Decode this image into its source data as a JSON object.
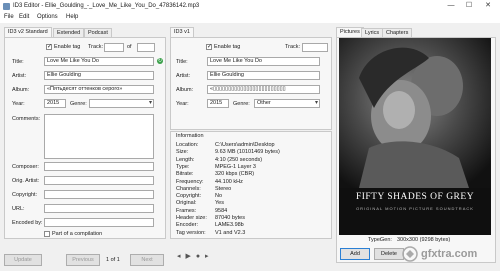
{
  "window": {
    "title": "ID3 Editor - Ellie_Goulding_-_Love_Me_Like_You_Do_47836142.mp3",
    "minimize": "—",
    "maximize": "☐",
    "close": "✕"
  },
  "menu": [
    "File",
    "Edit",
    "Options",
    "Help"
  ],
  "v2": {
    "tabs": [
      "ID3 v2 Standard",
      "Extended",
      "Podcast"
    ],
    "enable_tag": "Enable tag",
    "track_label": "Track:",
    "track_of": "of",
    "title_label": "Title:",
    "title": "Love Me Like You Do",
    "artist_label": "Artist:",
    "artist": "Ellie Goulding",
    "album_label": "Album:",
    "album": "«Пятьдесят оттенков серого»",
    "year_label": "Year:",
    "year": "2015",
    "genre_label": "Genre:",
    "comments_label": "Comments:",
    "composer_label": "Composer:",
    "orig_artist_label": "Orig. Artist:",
    "copyright_label": "Copyright:",
    "url_label": "URL:",
    "encoded_by_label": "Encoded by:",
    "compilation": "Part of a compilation"
  },
  "v1": {
    "tab": "ID3 v1",
    "enable_tag": "Enable tag",
    "track_label": "Track:",
    "title_label": "Title:",
    "title": "Love Me Like You Do",
    "artist_label": "Artist:",
    "artist": "Ellie Goulding",
    "album_label": "Album:",
    "album": "«▯▯▯▯▯▯▯▯▯▯▯▯▯▯▯▯▯▯▯▯▯▯▯▯",
    "year_label": "Year:",
    "year": "2015",
    "genre_label": "Genre:",
    "genre": "Other"
  },
  "info": {
    "header": "Information",
    "rows": [
      {
        "k": "Location:",
        "v": "C:\\Users\\admin\\Desktop"
      },
      {
        "k": "Size:",
        "v": "9.63 MB (10101469 bytes)"
      },
      {
        "k": "Length:",
        "v": "4:10 (250 seconds)"
      },
      {
        "k": "Type:",
        "v": "MPEG-1 Layer 3"
      },
      {
        "k": "Bitrate:",
        "v": "320 kbps (CBR)"
      },
      {
        "k": "Frequency:",
        "v": "44.100 kHz"
      },
      {
        "k": "Channels:",
        "v": "Stereo"
      },
      {
        "k": "Copyright:",
        "v": "No"
      },
      {
        "k": "Original:",
        "v": "Yes"
      },
      {
        "k": "Frames:",
        "v": "9584"
      },
      {
        "k": "Header size:",
        "v": "87040 bytes"
      },
      {
        "k": "Encoder:",
        "v": "LAME3.98b"
      },
      {
        "k": "Tag version:",
        "v": "V1 and V2.3"
      }
    ]
  },
  "right": {
    "tabs": [
      "Pictures",
      "Lyrics",
      "Chapters"
    ],
    "cover_title": "FIFTY SHADES OF GREY",
    "cover_subtitle": "ORIGINAL MOTION PICTURE SOUNDTRACK",
    "type_text": "Type:",
    "gen_text": "Gen:",
    "dims_text": "300x300 (9298 bytes)",
    "add": "Add",
    "delete": "Delete"
  },
  "footer": {
    "update": "Update",
    "previous": "Previous",
    "page": "1 of 1",
    "next": "Next"
  },
  "watermark": "gfxtra.com",
  "colors": {
    "green": "#3aa04a",
    "border": "#c9c9c9"
  }
}
